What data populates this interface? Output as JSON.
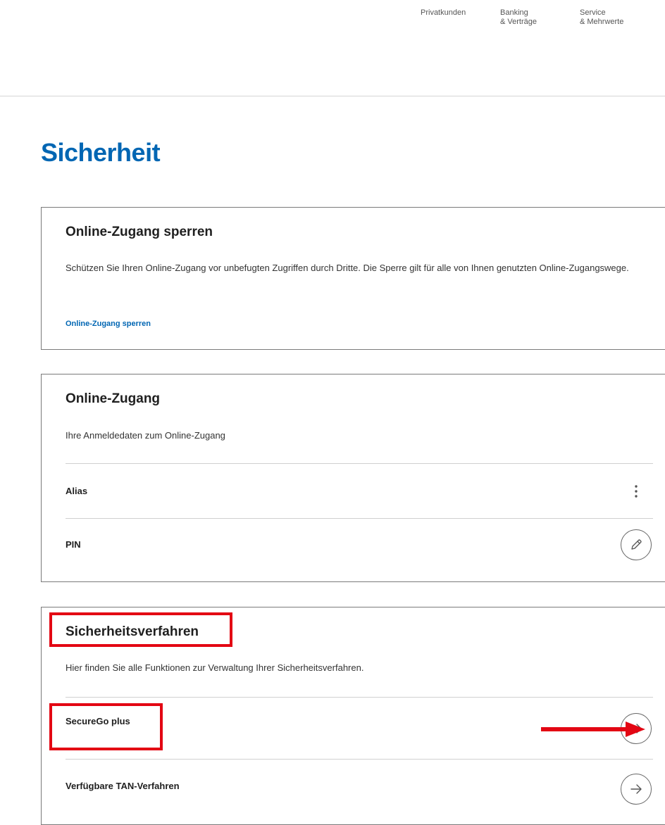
{
  "topnav": {
    "items": [
      {
        "label": "Privatkunden"
      },
      {
        "label": "Banking\n& Verträge"
      },
      {
        "label": "Service\n& Mehrwerte"
      }
    ]
  },
  "page": {
    "title": "Sicherheit"
  },
  "cards": {
    "lock": {
      "title": "Online-Zugang sperren",
      "text": "Schützen Sie Ihren Online-Zugang vor unbefugten Zugriffen durch Dritte. Die Sperre gilt für alle von Ihnen genutzten Online-Zugangswege.",
      "link": "Online-Zugang sperren"
    },
    "access": {
      "title": "Online-Zugang",
      "text": "Ihre Anmeldedaten zum Online-Zugang",
      "rows": [
        {
          "label": "Alias",
          "action_icon": "kebab-menu-icon"
        },
        {
          "label": "PIN",
          "action_icon": "pencil-icon"
        }
      ]
    },
    "security": {
      "title": "Sicherheitsverfahren",
      "text": "Hier finden Sie alle Funktionen zur Verwaltung Ihrer Sicherheitsverfahren.",
      "rows": [
        {
          "label": "SecureGo plus",
          "action_icon": "arrow-right-icon"
        },
        {
          "label": "Verfügbare TAN-Verfahren",
          "action_icon": "arrow-right-icon"
        }
      ]
    }
  },
  "colors": {
    "brand_blue": "#0066b3",
    "annotation_red": "#e30613",
    "card_border": "#7a7a7a"
  }
}
